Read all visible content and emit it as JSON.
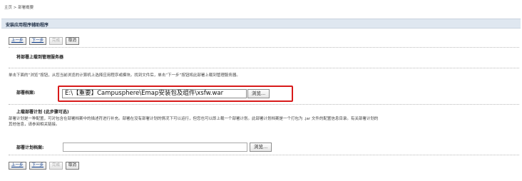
{
  "breadcrumb": "主页 > 部署概要",
  "window_title": "安装应用程序辅助程序",
  "nav_buttons": {
    "prev": "上一步",
    "next": "下一步",
    "finish": "完成",
    "cancel": "取消"
  },
  "section_upload": {
    "heading": "将部署上载到管理服务器",
    "description": "单击下面的“浏览”按钮，从您当前浏览的计算机上选择应用程序或模块。找到文件后，单击“下一步”按钮将此部署上载到管理服务器。",
    "archive_label": "部署档案:",
    "archive_value": "E:\\【重要】Campusphere\\Emap安装包及组件\\xsfw.war",
    "browse_label": "浏览..."
  },
  "section_plan": {
    "heading": "上载部署计划 (此步骤可选)",
    "description_line1": "部署计划是一种配置，可对包含在部署档案中的描述符进行补充。部署在没有部署计划的情况下可以运行，但您也可以即上载一个部署计划。此部署计划档案是一个打包为 .jar 文件的配置信息目录。有关部署计划的",
    "description_line2": "其他信息，请参阅相关链接。",
    "plan_label": "部署计划档案:",
    "plan_value": "",
    "browse_label": "浏览..."
  },
  "colors": {
    "title_bar_bg": "#dfe7f0",
    "highlight_border": "#d81a1a",
    "link_blue": "#0a3a8a"
  }
}
